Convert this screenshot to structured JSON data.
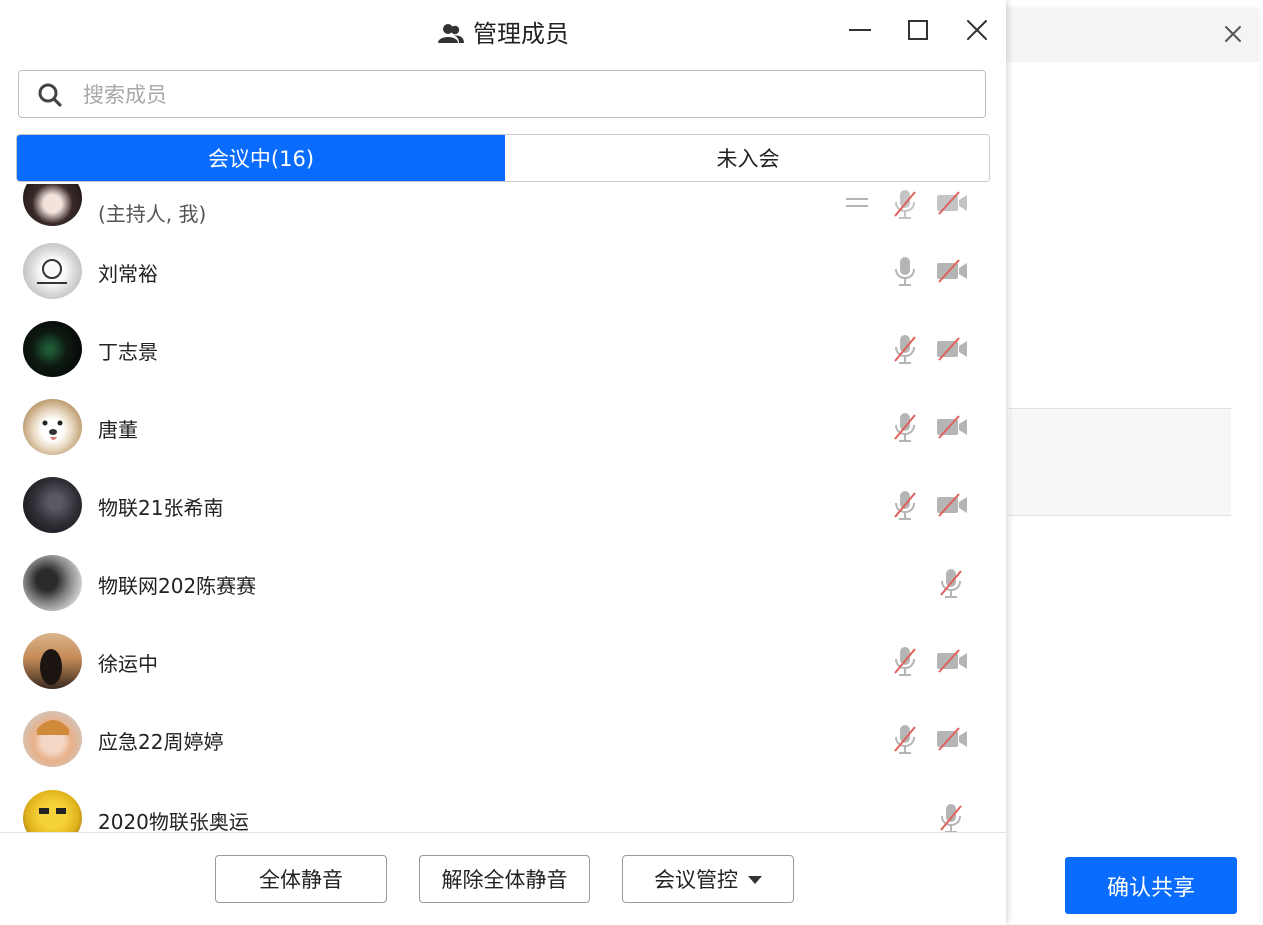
{
  "window": {
    "title": "管理成员",
    "title_icon": "people-icon"
  },
  "search": {
    "placeholder": "搜索成员",
    "value": ""
  },
  "tabs": [
    {
      "label": "会议中(16)",
      "active": true
    },
    {
      "label": "未入会",
      "active": false
    }
  ],
  "members": [
    {
      "name": "",
      "subtitle": "(主持人, 我)",
      "mic": "muted",
      "camera": "off"
    },
    {
      "name": "刘常裕",
      "mic": "on",
      "camera": "off"
    },
    {
      "name": "丁志景",
      "mic": "muted",
      "camera": "off"
    },
    {
      "name": "唐董",
      "mic": "muted",
      "camera": "off"
    },
    {
      "name": "物联21张希南",
      "mic": "muted",
      "camera": "off"
    },
    {
      "name": "物联网202陈赛赛",
      "mic": "muted",
      "camera": "none"
    },
    {
      "name": "徐运中",
      "mic": "muted",
      "camera": "off"
    },
    {
      "name": "应急22周婷婷",
      "mic": "muted",
      "camera": "off"
    },
    {
      "name": "2020物联张奥运",
      "mic": "muted",
      "camera": "none"
    }
  ],
  "footer": {
    "mute_all": "全体静音",
    "unmute_all": "解除全体静音",
    "meeting_control": "会议管控"
  },
  "background_window": {
    "confirm_label": "确认共享"
  },
  "colors": {
    "accent": "#0a6cff",
    "muted_red": "#e0605a",
    "icon_gray": "#b5b5b5"
  }
}
